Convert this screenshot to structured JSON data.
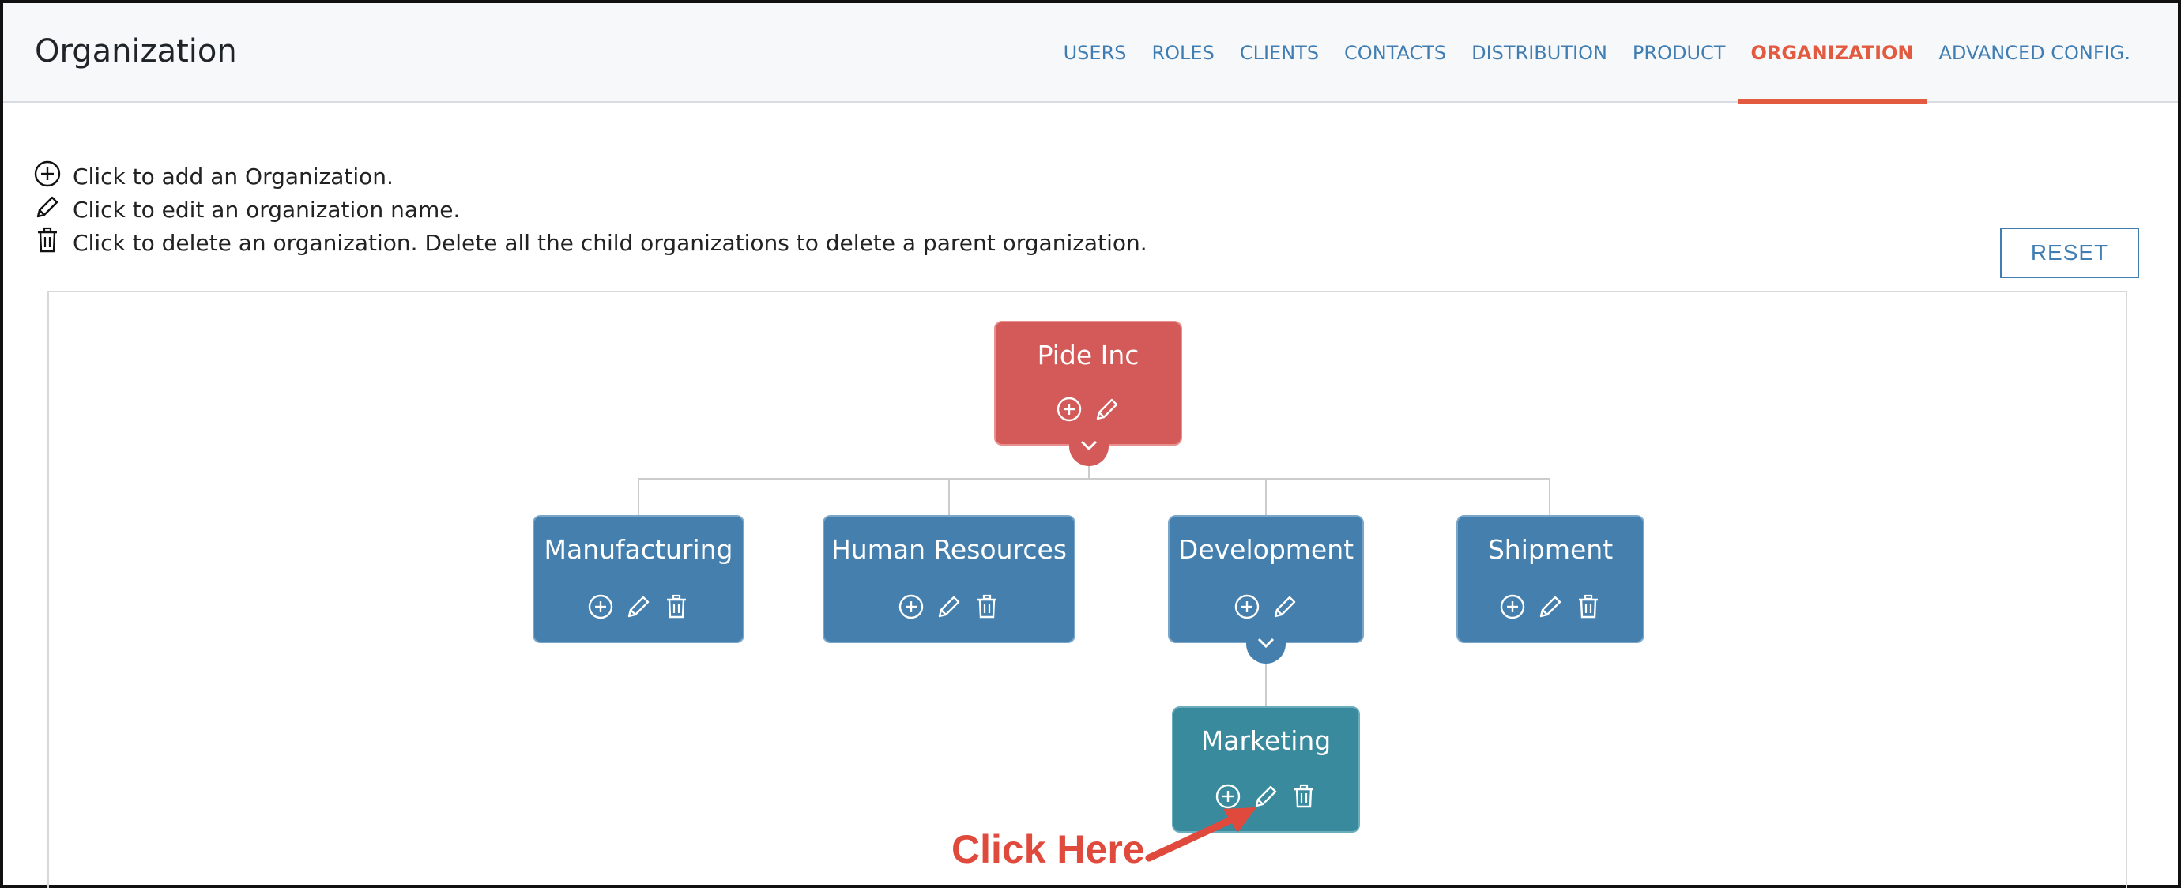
{
  "header": {
    "title": "Organization",
    "tabs": [
      {
        "label": "USERS",
        "active": false
      },
      {
        "label": "ROLES",
        "active": false
      },
      {
        "label": "CLIENTS",
        "active": false
      },
      {
        "label": "CONTACTS",
        "active": false
      },
      {
        "label": "DISTRIBUTION",
        "active": false
      },
      {
        "label": "PRODUCT",
        "active": false
      },
      {
        "label": "ORGANIZATION",
        "active": true
      },
      {
        "label": "ADVANCED CONFIG.",
        "active": false
      }
    ]
  },
  "legend": {
    "add": "Click to add an Organization.",
    "edit": "Click to edit an organization name.",
    "delete": "Click to delete an organization. Delete all the child organizations to delete a parent organization."
  },
  "reset_label": "RESET",
  "org_tree": {
    "root": {
      "name": "Pide Inc",
      "actions": [
        "add-icon",
        "edit-icon"
      ]
    },
    "children": [
      {
        "name": "Manufacturing",
        "actions": [
          "add-icon",
          "edit-icon",
          "delete-icon"
        ]
      },
      {
        "name": "Human Resources",
        "actions": [
          "add-icon",
          "edit-icon",
          "delete-icon"
        ]
      },
      {
        "name": "Development",
        "actions": [
          "add-icon",
          "edit-icon"
        ]
      },
      {
        "name": "Shipment",
        "actions": [
          "add-icon",
          "edit-icon",
          "delete-icon"
        ]
      }
    ],
    "grandchild": {
      "name": "Marketing",
      "parent": "Development",
      "actions": [
        "add-icon",
        "edit-icon",
        "delete-icon"
      ]
    }
  },
  "annotation": {
    "text": "Click Here"
  },
  "colors": {
    "accent": "#e25a3f",
    "link": "#3f7db3",
    "root_node": "#d35a58",
    "child_node": "#457fad",
    "grandchild_node": "#3a8a9e",
    "annotation": "#e04a3c"
  }
}
